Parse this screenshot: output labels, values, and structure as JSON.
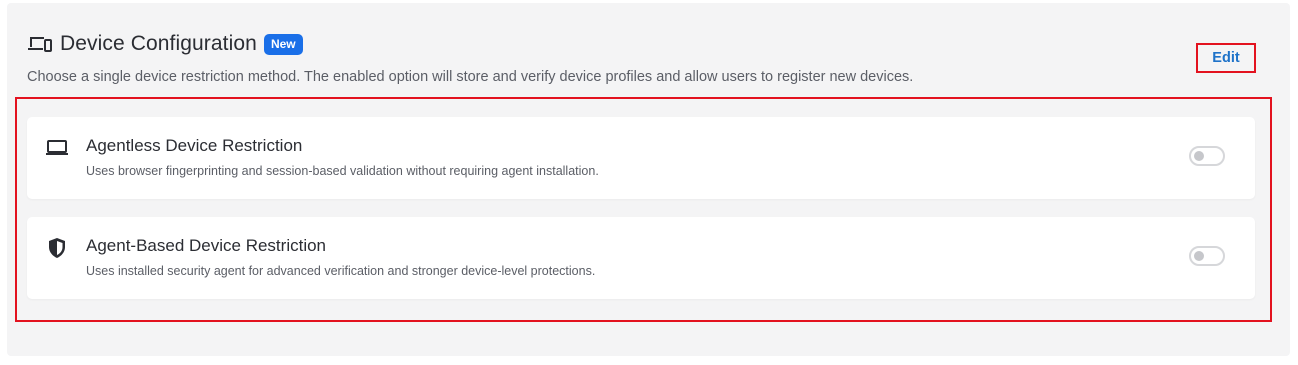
{
  "header": {
    "title": "Device Configuration",
    "badge": "New",
    "subtitle": "Choose a single device restriction method. The enabled option will store and verify device profiles and allow users to register new devices.",
    "edit_label": "Edit",
    "title_icon": "devices-icon"
  },
  "options": [
    {
      "title": "Agentless Device Restriction",
      "description": "Uses browser fingerprinting and session-based validation without requiring agent installation.",
      "icon": "laptop-icon",
      "enabled": false
    },
    {
      "title": "Agent-Based Device Restriction",
      "description": "Uses installed security agent for advanced verification and stronger device-level protections.",
      "icon": "shield-icon",
      "enabled": false
    }
  ],
  "colors": {
    "accent": "#1a6fe8",
    "link": "#1f73c9",
    "highlight_border": "#e3121f",
    "panel_bg": "#f4f4f5"
  }
}
